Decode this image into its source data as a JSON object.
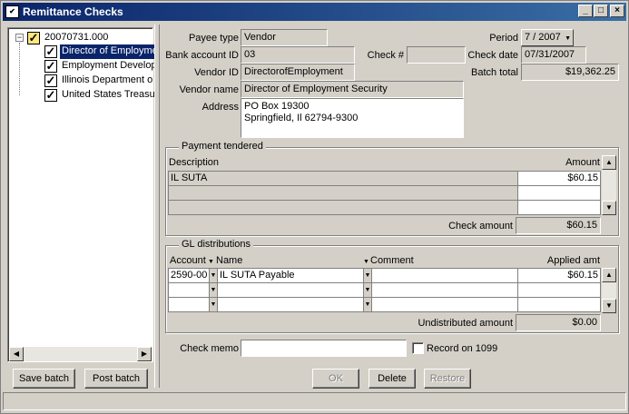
{
  "window": {
    "title": "Remittance Checks",
    "icon_glyph": "✔"
  },
  "tree": {
    "root": "20070731.000",
    "items": [
      "Director of Employme",
      "Employment Develop",
      "Illinois Department o",
      "United States Treasu"
    ]
  },
  "buttons": {
    "save_batch": "Save batch",
    "post_batch": "Post batch",
    "ok": "OK",
    "delete": "Delete",
    "restore": "Restore"
  },
  "form": {
    "payee_type_label": "Payee type",
    "payee_type": "Vendor",
    "period_label": "Period",
    "period": "7 / 2007",
    "bank_account_label": "Bank account ID",
    "bank_account": "03",
    "check_no_label": "Check #",
    "check_no": "",
    "check_date_label": "Check date",
    "check_date": "07/31/2007",
    "vendor_id_label": "Vendor ID",
    "vendor_id": "DirectorofEmployment",
    "batch_total_label": "Batch total",
    "batch_total": "$19,362.25",
    "vendor_name_label": "Vendor name",
    "vendor_name": "Director of Employment Security",
    "address_label": "Address",
    "address_line1": "PO Box 19300",
    "address_line2": "Springfield, Il  62794-9300"
  },
  "payment": {
    "title": "Payment tendered",
    "col_description": "Description",
    "col_amount": "Amount",
    "rows": [
      {
        "description": "IL SUTA",
        "amount": "$60.15"
      }
    ],
    "check_amount_label": "Check amount",
    "check_amount": "$60.15"
  },
  "gl": {
    "title": "GL distributions",
    "col_account": "Account",
    "col_name": "Name",
    "col_comment": "Comment",
    "col_applied": "Applied amt",
    "rows": [
      {
        "account": "2590-00",
        "name": "IL SUTA Payable",
        "comment": "",
        "applied": "$60.15"
      }
    ],
    "undistributed_label": "Undistributed amount",
    "undistributed": "$0.00"
  },
  "check_memo_label": "Check memo",
  "check_memo": "",
  "record_1099_label": "Record on 1099"
}
